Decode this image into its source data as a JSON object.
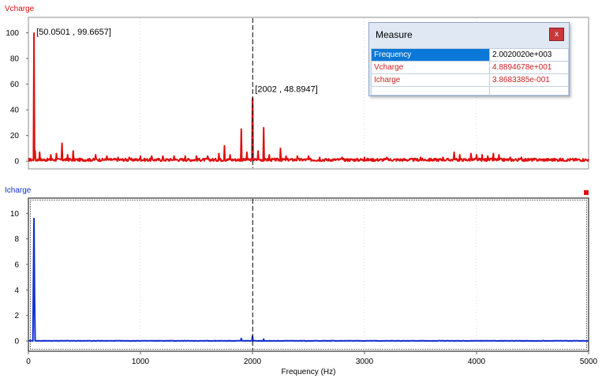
{
  "top_chart": {
    "title": "Vcharge",
    "color": "#e01010",
    "y_ticks": [
      "100",
      "80",
      "60",
      "40",
      "20",
      "0"
    ],
    "y_values": [
      100,
      80,
      60,
      40,
      20,
      0
    ],
    "ylim": [
      -6,
      112
    ],
    "annotations": [
      {
        "text": "[50.0501 , 99.6657]",
        "x": 50.05,
        "y": 99.67
      },
      {
        "text": "[2002 , 48.8947]",
        "x": 2002,
        "y": 48.89
      }
    ],
    "peaks": [
      [
        50,
        99.7
      ],
      [
        60,
        8
      ],
      [
        100,
        7
      ],
      [
        200,
        5
      ],
      [
        250,
        6
      ],
      [
        300,
        14
      ],
      [
        350,
        5
      ],
      [
        400,
        8
      ],
      [
        600,
        5
      ],
      [
        700,
        4
      ],
      [
        800,
        3
      ],
      [
        900,
        3
      ],
      [
        1000,
        4
      ],
      [
        1100,
        4
      ],
      [
        1200,
        4
      ],
      [
        1300,
        4
      ],
      [
        1400,
        4
      ],
      [
        1500,
        4
      ],
      [
        1600,
        4
      ],
      [
        1700,
        6
      ],
      [
        1750,
        12
      ],
      [
        1800,
        5
      ],
      [
        1900,
        25
      ],
      [
        1950,
        7
      ],
      [
        2002,
        48.9
      ],
      [
        2050,
        8
      ],
      [
        2100,
        26
      ],
      [
        2150,
        5
      ],
      [
        2250,
        10
      ],
      [
        2300,
        4
      ],
      [
        2400,
        4
      ],
      [
        2500,
        4
      ],
      [
        2600,
        3
      ],
      [
        2800,
        3
      ],
      [
        3000,
        3
      ],
      [
        3200,
        3
      ],
      [
        3500,
        3
      ],
      [
        3700,
        3
      ],
      [
        3800,
        7
      ],
      [
        3850,
        5
      ],
      [
        3950,
        6
      ],
      [
        4000,
        5
      ],
      [
        4050,
        5
      ],
      [
        4100,
        4
      ],
      [
        4150,
        6
      ],
      [
        4200,
        5
      ],
      [
        4300,
        3
      ],
      [
        4400,
        3
      ]
    ]
  },
  "bottom_chart": {
    "title": "Icharge",
    "color": "#1030d0",
    "y_ticks": [
      "10",
      "8",
      "6",
      "4",
      "2",
      "0"
    ],
    "y_values": [
      10,
      8,
      6,
      4,
      2,
      0
    ],
    "ylim": [
      -0.8,
      11.2
    ],
    "peaks": [
      [
        45,
        4.8
      ],
      [
        50,
        9.6
      ],
      [
        55,
        3.5
      ],
      [
        1900,
        0.2
      ],
      [
        2000,
        0.39
      ],
      [
        2100,
        0.15
      ]
    ]
  },
  "x_axis": {
    "label": "Frequency (Hz)",
    "ticks": [
      "0",
      "1000",
      "2000",
      "3000",
      "4000",
      "5000"
    ],
    "values": [
      0,
      1000,
      2000,
      3000,
      4000,
      5000
    ],
    "xlim": [
      0,
      5000
    ],
    "cursor_x": 2002
  },
  "measure": {
    "title": "Measure",
    "close_label": "x",
    "rows": [
      {
        "name": "Frequency",
        "value": "2.0020020e+003"
      },
      {
        "name": "Vcharge",
        "value": "4.8894678e+001"
      },
      {
        "name": "Icharge",
        "value": "3.8683385e-001"
      }
    ]
  }
}
